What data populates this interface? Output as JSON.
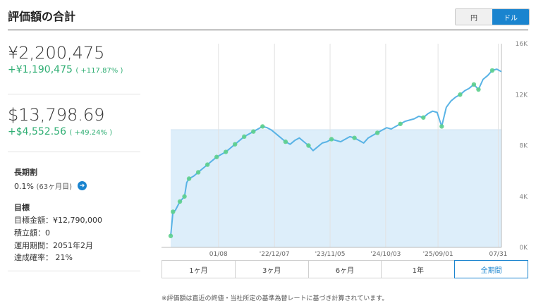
{
  "header": {
    "title": "評価額の合計"
  },
  "currency_toggle": {
    "yen": "円",
    "usd": "ドル",
    "selected": "usd"
  },
  "summary_yen": {
    "value": "¥2,200,475",
    "gain": "+¥1,190,475",
    "gain_pct": "( +117.87% )"
  },
  "summary_usd": {
    "value": "$13,798.69",
    "gain": "+$4,552.56",
    "gain_pct": "( +49.24% )"
  },
  "long_term": {
    "label": "長期割",
    "rate": "0.1%",
    "months": "(63ヶ月目)"
  },
  "goal": {
    "title": "目標",
    "rows": [
      "目標金額：¥12,790,000",
      "積立額：0",
      "運用期間：2051年2月",
      "達成確率： 21%"
    ]
  },
  "periods": {
    "items": [
      "1ヶ月",
      "3ヶ月",
      "6ヶ月",
      "1年",
      "全期間"
    ],
    "active_index": 4
  },
  "footnote": "※評価額は直近の終値・当社所定の基準為替レートに基づき計算されています。",
  "colors": {
    "accent": "#1a84cf",
    "gain": "#2fae73",
    "line": "#59b3e5",
    "fill": "#ddeefa",
    "marker": "#5ccf8c"
  },
  "chart_data": {
    "type": "line",
    "x_tick_labels": [
      "01/08",
      "'22/12/07",
      "'23/11/05",
      "'24/10/03",
      "'25/09/01",
      "07/31"
    ],
    "y_tick_labels": [
      "0K",
      "4K",
      "8K",
      "12K",
      "16K"
    ],
    "ylim": [
      0,
      16000
    ],
    "series": [
      {
        "points": [
          [
            0,
            900
          ],
          [
            0.5,
            2800
          ],
          [
            1,
            2900
          ],
          [
            2,
            3600
          ],
          [
            3,
            4000
          ],
          [
            3.5,
            5100
          ],
          [
            4,
            5400
          ],
          [
            5,
            5600
          ],
          [
            6,
            5900
          ],
          [
            7,
            6200
          ],
          [
            8,
            6500
          ],
          [
            9,
            6800
          ],
          [
            10,
            7100
          ],
          [
            11,
            7300
          ],
          [
            12,
            7500
          ],
          [
            13,
            7800
          ],
          [
            14,
            8100
          ],
          [
            15,
            8400
          ],
          [
            16,
            8700
          ],
          [
            17,
            8900
          ],
          [
            18,
            9100
          ],
          [
            19,
            9300
          ],
          [
            20,
            9500
          ],
          [
            21,
            9400
          ],
          [
            22,
            9200
          ],
          [
            23,
            8900
          ],
          [
            24,
            8600
          ],
          [
            25,
            8300
          ],
          [
            26,
            8100
          ],
          [
            27,
            8400
          ],
          [
            28,
            8600
          ],
          [
            29,
            8300
          ],
          [
            30,
            8000
          ],
          [
            31,
            7600
          ],
          [
            32,
            7900
          ],
          [
            33,
            8200
          ],
          [
            34,
            8300
          ],
          [
            35,
            8500
          ],
          [
            36,
            8400
          ],
          [
            37,
            8300
          ],
          [
            38,
            8500
          ],
          [
            39,
            8700
          ],
          [
            40,
            8600
          ],
          [
            41,
            8400
          ],
          [
            42,
            8200
          ],
          [
            43,
            8600
          ],
          [
            44,
            8800
          ],
          [
            45,
            9000
          ],
          [
            46,
            9200
          ],
          [
            47,
            9400
          ],
          [
            48,
            9300
          ],
          [
            49,
            9500
          ],
          [
            50,
            9700
          ],
          [
            51,
            9900
          ],
          [
            52,
            10000
          ],
          [
            53,
            10100
          ],
          [
            54,
            10300
          ],
          [
            55,
            10200
          ],
          [
            56,
            10500
          ],
          [
            57,
            10700
          ],
          [
            58,
            10600
          ],
          [
            59,
            9500
          ],
          [
            60,
            11000
          ],
          [
            61,
            11500
          ],
          [
            62,
            11800
          ],
          [
            63,
            12000
          ],
          [
            64,
            12300
          ],
          [
            65,
            12500
          ],
          [
            66,
            12800
          ],
          [
            67,
            12400
          ],
          [
            68,
            13200
          ],
          [
            69,
            13500
          ],
          [
            70,
            13900
          ],
          [
            71,
            14000
          ],
          [
            72,
            13799
          ]
        ],
        "markers": [
          0,
          0.5,
          2,
          3,
          4,
          6,
          8,
          10,
          12,
          14,
          16,
          18,
          20,
          25,
          30,
          35,
          40,
          45,
          50,
          55,
          59,
          63,
          66,
          67,
          70
        ]
      }
    ],
    "reference_line": 9246,
    "x_domain": [
      -2,
      72
    ]
  }
}
